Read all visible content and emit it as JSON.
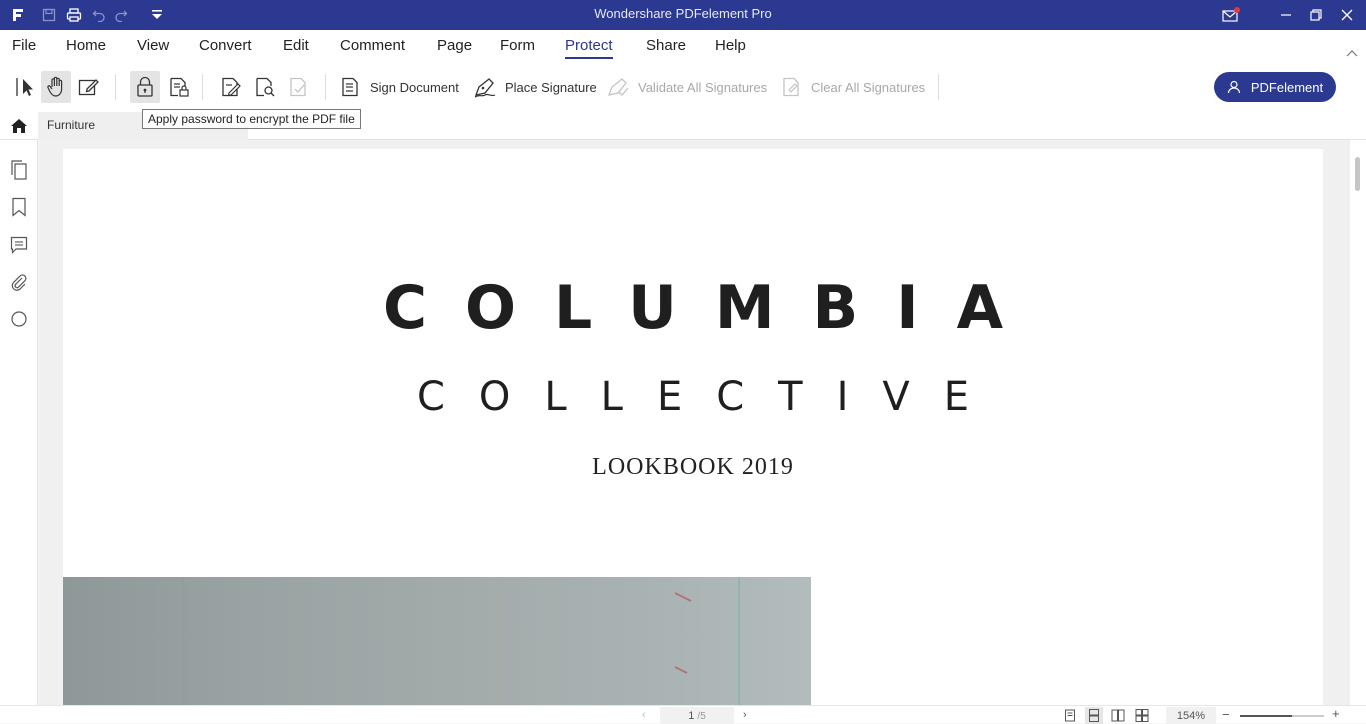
{
  "window": {
    "title": "Wondershare PDFelement Pro",
    "mail_badge_color": "#e53935"
  },
  "menu": {
    "items": [
      "File",
      "Home",
      "View",
      "Convert",
      "Edit",
      "Comment",
      "Page",
      "Form",
      "Protect",
      "Share",
      "Help"
    ],
    "active": "Protect"
  },
  "toolbar": {
    "sign_document": "Sign Document",
    "place_signature": "Place Signature",
    "validate_all": "Validate All Signatures",
    "clear_all": "Clear All Signatures",
    "account": "PDFelement"
  },
  "tabs": {
    "document": "Furniture"
  },
  "tooltip": "Apply password to encrypt the PDF file",
  "document": {
    "line1": "COLUMBIA",
    "line2": "COLLECTIVE",
    "line3": "LOOKBOOK 2019"
  },
  "status": {
    "current_page": "1",
    "total_pages": "/5",
    "zoom": "154%",
    "zoom_slider_level": 0.62
  },
  "colors": {
    "accent": "#2b3990"
  }
}
